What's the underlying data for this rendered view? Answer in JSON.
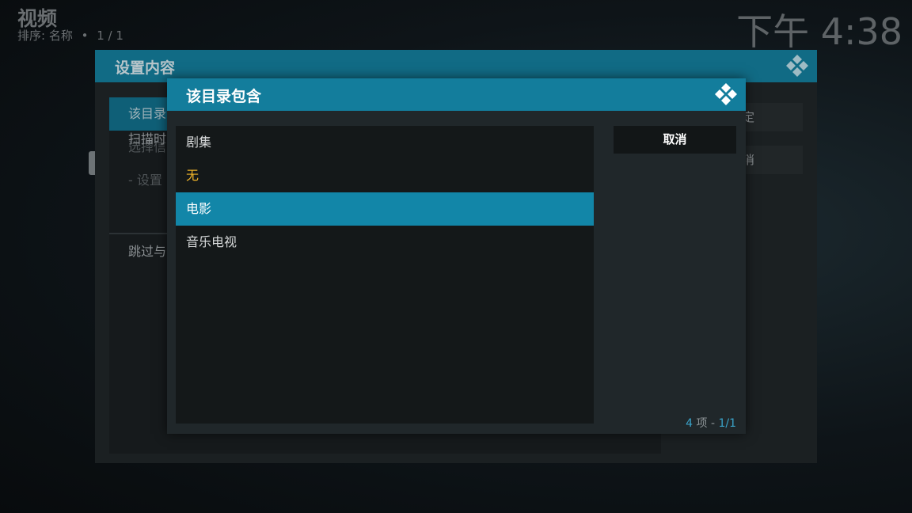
{
  "header": {
    "title": "视频",
    "sort_label": "排序: 名称",
    "separator": "•",
    "page": "1 / 1"
  },
  "clock": "下午 4:38",
  "background_dialog": {
    "title": "设置内容",
    "items": [
      {
        "label": "该目录"
      },
      {
        "label": "选择信"
      },
      {
        "label": "- 设置"
      },
      {
        "label": "扫描时"
      },
      {
        "label": "跳过与"
      }
    ],
    "buttons": [
      {
        "label": "定"
      },
      {
        "label": "消"
      }
    ]
  },
  "dialog": {
    "title": "该目录包含",
    "items": [
      {
        "label": "剧集"
      },
      {
        "label": "无"
      },
      {
        "label": "电影"
      },
      {
        "label": "音乐电视"
      }
    ],
    "cancel_label": "取消",
    "count_number": "4",
    "count_unit": " 项 - ",
    "count_page": "1/1"
  },
  "colors": {
    "accent": "#1286a8",
    "header": "#137d9c",
    "selected_text": "#f0b429"
  },
  "icons": {
    "logo": "kodi-logo-icon"
  }
}
